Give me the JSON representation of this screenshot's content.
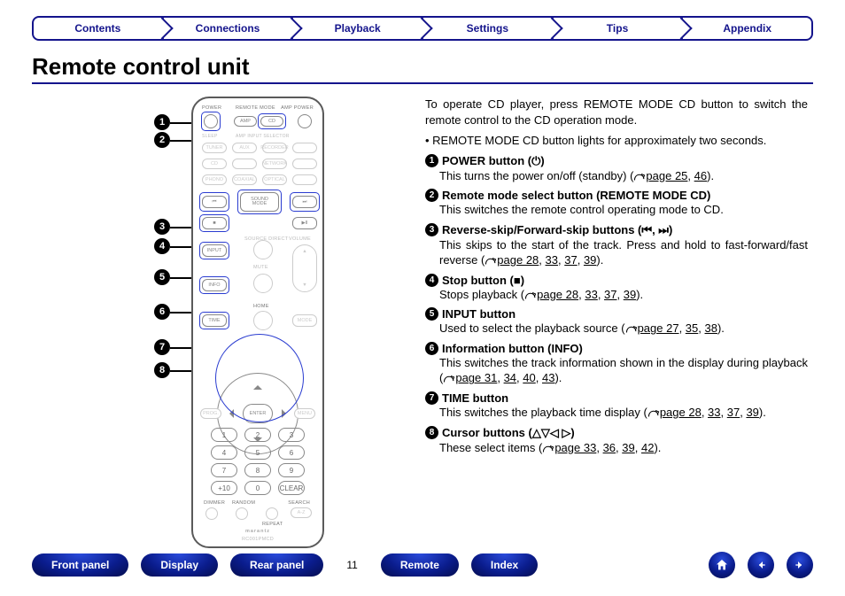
{
  "nav": {
    "tabs": [
      "Contents",
      "Connections",
      "Playback",
      "Settings",
      "Tips",
      "Appendix"
    ]
  },
  "heading": "Remote control unit",
  "intro": {
    "para": "To operate CD player, press REMOTE MODE CD button to switch the remote control to the CD operation mode.",
    "bullet": "REMOTE MODE CD button lights for approximately two seconds."
  },
  "items": [
    {
      "n": "1",
      "title": "POWER button (⏻)",
      "body": "This turns the power on/off (standby) (",
      "links": [
        "page 25",
        "46"
      ],
      "after": ")."
    },
    {
      "n": "2",
      "title": "Remote mode select button (REMOTE MODE CD)",
      "body": "This switches the remote control operating mode to CD.",
      "links": [],
      "after": ""
    },
    {
      "n": "3",
      "title": "Reverse-skip/Forward-skip buttons (⏮, ⏭)",
      "body": "This skips to the start of the track. Press and hold to fast-forward/fast reverse (",
      "links": [
        "page 28",
        "33",
        "37",
        "39"
      ],
      "after": ")."
    },
    {
      "n": "4",
      "title": "Stop button (■)",
      "body": "Stops playback (",
      "links": [
        "page 28",
        "33",
        "37",
        "39"
      ],
      "after": ")."
    },
    {
      "n": "5",
      "title": "INPUT button",
      "body": "Used to select the playback source (",
      "links": [
        "page 27",
        "35",
        "38"
      ],
      "after": ")."
    },
    {
      "n": "6",
      "title": "Information button (INFO)",
      "body": "This switches the track information shown in the display during playback (",
      "links": [
        "page 31",
        "34",
        "40",
        "43"
      ],
      "after": ")."
    },
    {
      "n": "7",
      "title": "TIME button",
      "body": "This switches the playback time display (",
      "links": [
        "page 28",
        "33",
        "37",
        "39"
      ],
      "after": ")."
    },
    {
      "n": "8",
      "title": "Cursor buttons (△▽◁ ▷)",
      "body": "These select items (",
      "links": [
        "page 33",
        "36",
        "39",
        "42"
      ],
      "after": ")."
    }
  ],
  "bottom": {
    "buttons": [
      "Front panel",
      "Display",
      "Rear panel"
    ],
    "page": "11",
    "buttons2": [
      "Remote",
      "Index"
    ]
  },
  "remote_labels": {
    "power": "POWER",
    "remote_mode": "REMOTE MODE",
    "amp_power": "AMP POWER",
    "amp": "AMP",
    "cd": "CD",
    "tuner": "TUNER",
    "aux": "AUX",
    "recorder": "RECORDER",
    "cd_src": "CD",
    "network": "NETWORK",
    "phono": "PHONO",
    "coaxial": "COAXIAL",
    "optical": "OPTICAL",
    "sound_mode": "SOUND\nMODE",
    "input": "INPUT",
    "mute": "MUTE",
    "info": "INFO",
    "volume": "VOLUME",
    "time": "TIME",
    "home": "HOME",
    "mode": "MODE",
    "prog": "PROG.",
    "menu": "MENU",
    "enter": "ENTER",
    "clear": "CLEAR",
    "plus10": "+10",
    "zero": "0",
    "dimmer": "DIMMER",
    "random": "RANDOM",
    "search": "SEARCH",
    "az": "A-Z",
    "repeat": "REPEAT",
    "brand": "marantz",
    "model": "RC001PMCD",
    "source_direct": "SOURCE DIRECT"
  }
}
